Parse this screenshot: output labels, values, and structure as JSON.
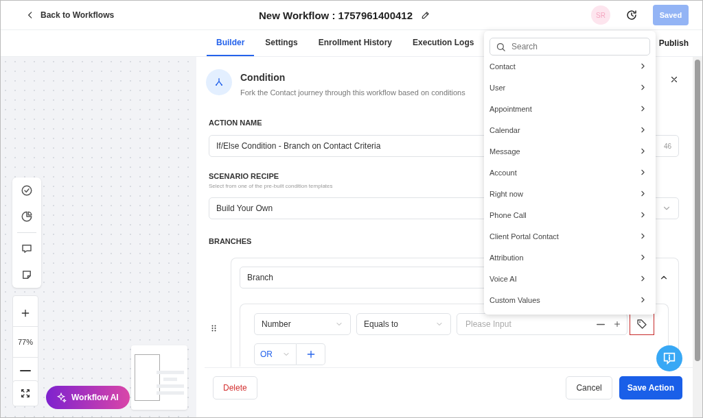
{
  "header": {
    "back_link": "Back to Workflows",
    "title": "New Workflow : 1757961400412",
    "avatar": "SR",
    "save_button": {
      "label": "Saved",
      "disabled": true
    }
  },
  "tabs": [
    {
      "label": "Builder",
      "selected": true
    },
    {
      "label": "Settings",
      "selected": false
    },
    {
      "label": "Enrollment History",
      "selected": false
    },
    {
      "label": "Execution Logs",
      "selected": false
    }
  ],
  "publish": "Publish",
  "canvas": {
    "zoom": "77%",
    "ai_button": "Workflow AI"
  },
  "panel": {
    "title": "Condition",
    "subtitle": "Fork the Contact journey through this workflow based on conditions",
    "action_name": {
      "label": "ACTION NAME",
      "value": "If/Else Condition - Branch on Contact Criteria",
      "counter": "46"
    },
    "scenario": {
      "label": "SCENARIO RECIPE",
      "hint": "Select from one of the pre-built condition templates",
      "value": "Build Your Own"
    },
    "branches_label": "BRANCHES",
    "branch": {
      "name": "Branch",
      "expanded": true,
      "condition": {
        "field": "Number",
        "operator": "Equals to",
        "placeholder": "Please Input"
      },
      "connector": "OR"
    },
    "delete": "Delete",
    "cancel": "Cancel",
    "save": "Save Action"
  },
  "dropdown": {
    "search_placeholder": "Search",
    "items": [
      {
        "label": "Contact"
      },
      {
        "label": "User"
      },
      {
        "label": "Appointment"
      },
      {
        "label": "Calendar"
      },
      {
        "label": "Message"
      },
      {
        "label": "Account"
      },
      {
        "label": "Right now"
      },
      {
        "label": "Phone Call"
      },
      {
        "label": "Client Portal Contact"
      },
      {
        "label": "Attribution"
      },
      {
        "label": "Voice AI"
      },
      {
        "label": "Custom Values"
      }
    ]
  }
}
